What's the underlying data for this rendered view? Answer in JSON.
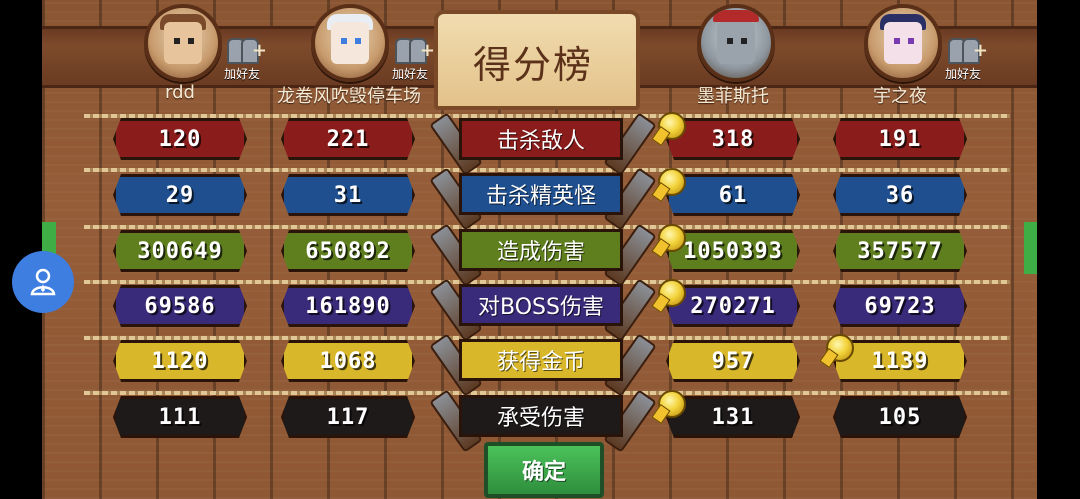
{
  "header": {
    "title": "得分榜"
  },
  "players": [
    {
      "name": "rdd",
      "add_friend": "加好友"
    },
    {
      "name": "龙卷风吹毁停车场",
      "add_friend": "加好友"
    },
    {
      "name": "墨菲斯托"
    },
    {
      "name": "宇之夜",
      "add_friend": "加好友"
    }
  ],
  "categories": [
    {
      "label": "击杀敌人",
      "values": [
        "120",
        "221",
        "318",
        "191"
      ],
      "color": "#8a1c1c",
      "leader": 2
    },
    {
      "label": "击杀精英怪",
      "values": [
        "29",
        "31",
        "61",
        "36"
      ],
      "color": "#1f4f8e",
      "leader": 2
    },
    {
      "label": "造成伤害",
      "values": [
        "300649",
        "650892",
        "1050393",
        "357577"
      ],
      "color": "#5f7f1e",
      "leader": 2
    },
    {
      "label": "对BOSS伤害",
      "values": [
        "69586",
        "161890",
        "270271",
        "69723"
      ],
      "color": "#3a2a7a",
      "leader": 2
    },
    {
      "label": "获得金币",
      "values": [
        "1120",
        "1068",
        "957",
        "1139"
      ],
      "color": "#d8b82a",
      "leader": 3
    },
    {
      "label": "承受伤害",
      "values": [
        "111",
        "117",
        "131",
        "105"
      ],
      "color": "#1e1a1a",
      "leader": 2
    }
  ],
  "confirm_label": "确定",
  "icons": {
    "assist": "person-icon",
    "add_friend": "add-friend-icon",
    "medal": "medal-icon"
  }
}
